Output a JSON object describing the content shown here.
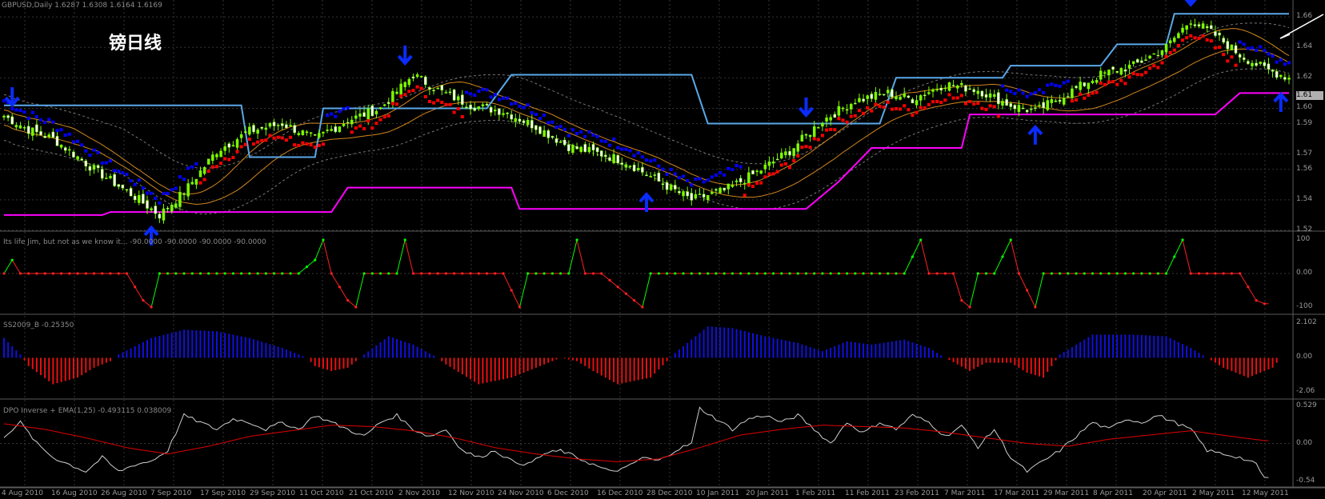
{
  "window": {
    "symbol_line": "GBPUSD,Daily  1.6287 1.6308 1.6164 1.6169",
    "annotation": "镑日线",
    "last_price_tag": "1.61"
  },
  "colors": {
    "background": "#000000",
    "grid": "#333333",
    "bull_candle": "#7cfc00",
    "bear_candle": "#ffffff",
    "upper_channel": "#5aa8e8",
    "lower_channel": "#ff00ff",
    "ema_band": "#d2861e",
    "envelope": "#777777",
    "trailing_stop_up": "#ff0000",
    "trailing_stop_down": "#0000ff",
    "arrows": "#0a2cff",
    "osc_up": "#00ff00",
    "osc_down": "#ff2020",
    "hist_pos": "#1010e0",
    "hist_neg": "#e81010",
    "line_white": "#d0d0d0",
    "line_red": "#e00000"
  },
  "chart_data": [
    {
      "type": "candlestick",
      "name": "price",
      "ylim": [
        1.52,
        1.67
      ],
      "ytick_labels": [
        "1.66",
        "1.64",
        "1.62",
        "1.60",
        "1.59",
        "1.57",
        "1.56",
        "1.54",
        "1.52"
      ],
      "ytick_values": [
        1.66,
        1.64,
        1.62,
        1.6,
        1.59,
        1.57,
        1.56,
        1.54,
        1.52
      ],
      "keypoints_close": [
        [
          0,
          1.595
        ],
        [
          6,
          1.586
        ],
        [
          12,
          1.58
        ],
        [
          22,
          1.56
        ],
        [
          32,
          1.542
        ],
        [
          38,
          1.53
        ],
        [
          44,
          1.545
        ],
        [
          52,
          1.572
        ],
        [
          60,
          1.585
        ],
        [
          68,
          1.59
        ],
        [
          76,
          1.58
        ],
        [
          84,
          1.592
        ],
        [
          92,
          1.6
        ],
        [
          100,
          1.622
        ],
        [
          106,
          1.612
        ],
        [
          114,
          1.602
        ],
        [
          122,
          1.598
        ],
        [
          130,
          1.588
        ],
        [
          138,
          1.575
        ],
        [
          146,
          1.57
        ],
        [
          152,
          1.565
        ],
        [
          160,
          1.552
        ],
        [
          168,
          1.54
        ],
        [
          176,
          1.546
        ],
        [
          184,
          1.558
        ],
        [
          192,
          1.572
        ],
        [
          200,
          1.592
        ],
        [
          208,
          1.605
        ],
        [
          216,
          1.61
        ],
        [
          222,
          1.606
        ],
        [
          230,
          1.616
        ],
        [
          238,
          1.612
        ],
        [
          246,
          1.602
        ],
        [
          252,
          1.598
        ],
        [
          260,
          1.61
        ],
        [
          268,
          1.622
        ],
        [
          276,
          1.628
        ],
        [
          284,
          1.64
        ],
        [
          290,
          1.658
        ],
        [
          296,
          1.648
        ],
        [
          302,
          1.635
        ],
        [
          308,
          1.626
        ],
        [
          314,
          1.62
        ]
      ],
      "upper_channel_steps": [
        [
          0,
          1.602
        ],
        [
          58,
          1.602
        ],
        [
          60,
          1.568
        ],
        [
          76,
          1.568
        ],
        [
          78,
          1.6
        ],
        [
          118,
          1.6
        ],
        [
          124,
          1.622
        ],
        [
          168,
          1.622
        ],
        [
          172,
          1.59
        ],
        [
          214,
          1.59
        ],
        [
          218,
          1.62
        ],
        [
          244,
          1.62
        ],
        [
          246,
          1.628
        ],
        [
          268,
          1.628
        ],
        [
          272,
          1.642
        ],
        [
          284,
          1.642
        ],
        [
          286,
          1.662
        ],
        [
          314,
          1.662
        ]
      ],
      "lower_channel_steps": [
        [
          0,
          1.53
        ],
        [
          24,
          1.53
        ],
        [
          26,
          1.532
        ],
        [
          80,
          1.532
        ],
        [
          84,
          1.548
        ],
        [
          124,
          1.548
        ],
        [
          126,
          1.534
        ],
        [
          196,
          1.534
        ],
        [
          204,
          1.552
        ],
        [
          212,
          1.574
        ],
        [
          234,
          1.574
        ],
        [
          236,
          1.596
        ],
        [
          296,
          1.596
        ],
        [
          302,
          1.61
        ],
        [
          314,
          1.61
        ]
      ],
      "arrows_down_at": [
        2,
        98,
        196,
        290
      ],
      "arrows_up_at": [
        36,
        157,
        252,
        312
      ]
    },
    {
      "type": "line",
      "name": "Its life Jim, but not as we know it... -90.0000 -90.0000 -90.0000 -90.0000",
      "ytick_labels": [
        "100",
        "0.00",
        "-100"
      ],
      "ylim": [
        -100,
        100
      ],
      "keypoints": [
        [
          0,
          0
        ],
        [
          2,
          40
        ],
        [
          4,
          0
        ],
        [
          30,
          0
        ],
        [
          34,
          -80
        ],
        [
          36,
          -100
        ],
        [
          38,
          0
        ],
        [
          40,
          0
        ],
        [
          72,
          0
        ],
        [
          76,
          40
        ],
        [
          78,
          100
        ],
        [
          80,
          0
        ],
        [
          84,
          -80
        ],
        [
          86,
          -100
        ],
        [
          88,
          0
        ],
        [
          96,
          0
        ],
        [
          98,
          100
        ],
        [
          100,
          0
        ],
        [
          104,
          0
        ],
        [
          122,
          0
        ],
        [
          126,
          -100
        ],
        [
          128,
          0
        ],
        [
          138,
          0
        ],
        [
          140,
          100
        ],
        [
          142,
          0
        ],
        [
          146,
          0
        ],
        [
          154,
          -80
        ],
        [
          156,
          -100
        ],
        [
          158,
          0
        ],
        [
          220,
          0
        ],
        [
          224,
          100
        ],
        [
          226,
          0
        ],
        [
          232,
          0
        ],
        [
          234,
          -80
        ],
        [
          236,
          -100
        ],
        [
          238,
          0
        ],
        [
          242,
          0
        ],
        [
          246,
          100
        ],
        [
          248,
          0
        ],
        [
          252,
          -100
        ],
        [
          254,
          0
        ],
        [
          284,
          0
        ],
        [
          288,
          100
        ],
        [
          290,
          0
        ],
        [
          302,
          0
        ],
        [
          306,
          -80
        ],
        [
          308,
          -90
        ]
      ]
    },
    {
      "type": "bar",
      "name": "SS2009_B -0.25350",
      "ytick_labels": [
        "2.102",
        "0.00",
        "-2.06"
      ],
      "ylim": [
        -2.06,
        2.102
      ],
      "keypoints": [
        [
          0,
          1.2
        ],
        [
          4,
          0.2
        ],
        [
          6,
          -0.5
        ],
        [
          12,
          -1.6
        ],
        [
          18,
          -1.2
        ],
        [
          22,
          -0.6
        ],
        [
          26,
          -0.2
        ],
        [
          28,
          0.2
        ],
        [
          36,
          1.2
        ],
        [
          44,
          1.7
        ],
        [
          52,
          1.6
        ],
        [
          60,
          1.2
        ],
        [
          68,
          0.6
        ],
        [
          74,
          0.0
        ],
        [
          76,
          -0.5
        ],
        [
          80,
          -0.8
        ],
        [
          84,
          -0.6
        ],
        [
          88,
          0.2
        ],
        [
          94,
          1.3
        ],
        [
          100,
          0.8
        ],
        [
          106,
          0.0
        ],
        [
          108,
          -0.4
        ],
        [
          116,
          -1.6
        ],
        [
          124,
          -1.2
        ],
        [
          132,
          -0.4
        ],
        [
          136,
          0.0
        ],
        [
          140,
          -0.2
        ],
        [
          144,
          -0.8
        ],
        [
          150,
          -1.6
        ],
        [
          158,
          -1.2
        ],
        [
          162,
          -0.2
        ],
        [
          164,
          0.3
        ],
        [
          172,
          1.9
        ],
        [
          178,
          1.8
        ],
        [
          186,
          1.3
        ],
        [
          194,
          0.9
        ],
        [
          200,
          0.4
        ],
        [
          206,
          1.0
        ],
        [
          212,
          0.8
        ],
        [
          220,
          1.1
        ],
        [
          226,
          0.6
        ],
        [
          230,
          0.0
        ],
        [
          236,
          -0.8
        ],
        [
          240,
          -0.3
        ],
        [
          246,
          -0.3
        ],
        [
          250,
          -0.9
        ],
        [
          254,
          -1.2
        ],
        [
          258,
          0.2
        ],
        [
          266,
          1.4
        ],
        [
          276,
          1.4
        ],
        [
          284,
          1.3
        ],
        [
          290,
          0.6
        ],
        [
          294,
          0.0
        ],
        [
          298,
          -0.6
        ],
        [
          304,
          -1.2
        ],
        [
          310,
          -0.6
        ],
        [
          312,
          0.0
        ]
      ]
    },
    {
      "type": "line",
      "name": "DPO Inverse + EMA(1,25) -0.493115 0.038009",
      "ytick_labels": [
        "0.529",
        "0.00",
        "-0.54"
      ],
      "ylim": [
        -0.54,
        0.529
      ],
      "series_white": [
        [
          0,
          0.1
        ],
        [
          4,
          0.3
        ],
        [
          8,
          0.0
        ],
        [
          12,
          -0.2
        ],
        [
          16,
          -0.3
        ],
        [
          20,
          -0.4
        ],
        [
          24,
          -0.2
        ],
        [
          28,
          -0.4
        ],
        [
          32,
          -0.3
        ],
        [
          36,
          -0.25
        ],
        [
          40,
          -0.1
        ],
        [
          44,
          0.4
        ],
        [
          48,
          0.3
        ],
        [
          52,
          0.2
        ],
        [
          56,
          0.35
        ],
        [
          60,
          0.3
        ],
        [
          64,
          0.2
        ],
        [
          68,
          0.3
        ],
        [
          72,
          0.2
        ],
        [
          76,
          0.4
        ],
        [
          80,
          0.3
        ],
        [
          84,
          0.2
        ],
        [
          88,
          0.1
        ],
        [
          92,
          0.3
        ],
        [
          96,
          0.4
        ],
        [
          100,
          0.2
        ],
        [
          104,
          0.1
        ],
        [
          108,
          0.2
        ],
        [
          112,
          -0.1
        ],
        [
          116,
          -0.2
        ],
        [
          120,
          -0.1
        ],
        [
          124,
          -0.25
        ],
        [
          128,
          -0.3
        ],
        [
          132,
          -0.15
        ],
        [
          136,
          -0.1
        ],
        [
          140,
          -0.2
        ],
        [
          144,
          -0.3
        ],
        [
          148,
          -0.4
        ],
        [
          152,
          -0.35
        ],
        [
          156,
          -0.2
        ],
        [
          160,
          -0.25
        ],
        [
          164,
          -0.1
        ],
        [
          168,
          0.0
        ],
        [
          170,
          0.5
        ],
        [
          174,
          0.35
        ],
        [
          178,
          0.2
        ],
        [
          182,
          0.35
        ],
        [
          186,
          0.4
        ],
        [
          190,
          0.3
        ],
        [
          194,
          0.4
        ],
        [
          198,
          0.2
        ],
        [
          202,
          0.0
        ],
        [
          206,
          0.3
        ],
        [
          210,
          0.15
        ],
        [
          214,
          0.3
        ],
        [
          218,
          0.2
        ],
        [
          222,
          0.4
        ],
        [
          226,
          0.3
        ],
        [
          230,
          0.1
        ],
        [
          234,
          0.25
        ],
        [
          238,
          -0.05
        ],
        [
          242,
          0.2
        ],
        [
          246,
          -0.2
        ],
        [
          250,
          -0.4
        ],
        [
          254,
          -0.25
        ],
        [
          258,
          -0.1
        ],
        [
          262,
          0.1
        ],
        [
          266,
          0.3
        ],
        [
          270,
          0.2
        ],
        [
          274,
          0.35
        ],
        [
          278,
          0.3
        ],
        [
          282,
          0.4
        ],
        [
          286,
          0.3
        ],
        [
          290,
          0.2
        ],
        [
          294,
          -0.1
        ],
        [
          298,
          -0.15
        ],
        [
          302,
          -0.2
        ],
        [
          306,
          -0.3
        ],
        [
          308,
          -0.49
        ]
      ],
      "series_red": [
        [
          0,
          0.28
        ],
        [
          10,
          0.2
        ],
        [
          20,
          0.08
        ],
        [
          30,
          -0.06
        ],
        [
          40,
          -0.15
        ],
        [
          50,
          -0.04
        ],
        [
          60,
          0.1
        ],
        [
          70,
          0.18
        ],
        [
          80,
          0.26
        ],
        [
          90,
          0.24
        ],
        [
          100,
          0.18
        ],
        [
          110,
          0.08
        ],
        [
          120,
          -0.06
        ],
        [
          130,
          -0.15
        ],
        [
          140,
          -0.22
        ],
        [
          150,
          -0.26
        ],
        [
          160,
          -0.22
        ],
        [
          170,
          -0.06
        ],
        [
          180,
          0.12
        ],
        [
          190,
          0.2
        ],
        [
          200,
          0.26
        ],
        [
          210,
          0.24
        ],
        [
          220,
          0.22
        ],
        [
          230,
          0.16
        ],
        [
          240,
          0.08
        ],
        [
          250,
          0.0
        ],
        [
          260,
          -0.04
        ],
        [
          270,
          0.06
        ],
        [
          280,
          0.12
        ],
        [
          290,
          0.18
        ],
        [
          300,
          0.1
        ],
        [
          308,
          0.04
        ]
      ]
    }
  ],
  "x_axis": {
    "labels": [
      "4 Aug 2010",
      "16 Aug 2010",
      "26 Aug 2010",
      "7 Sep 2010",
      "17 Sep 2010",
      "29 Sep 2010",
      "11 Oct 2010",
      "21 Oct 2010",
      "2 Nov 2010",
      "12 Nov 2010",
      "24 Nov 2010",
      "6 Dec 2010",
      "16 Dec 2010",
      "28 Dec 2010",
      "10 Jan 2011",
      "20 Jan 2011",
      "1 Feb 2011",
      "11 Feb 2011",
      "23 Feb 2011",
      "7 Mar 2011",
      "17 Mar 2011",
      "29 Mar 2011",
      "8 Apr 2011",
      "20 Apr 2011",
      "2 May 2011",
      "12 May 2011"
    ]
  }
}
